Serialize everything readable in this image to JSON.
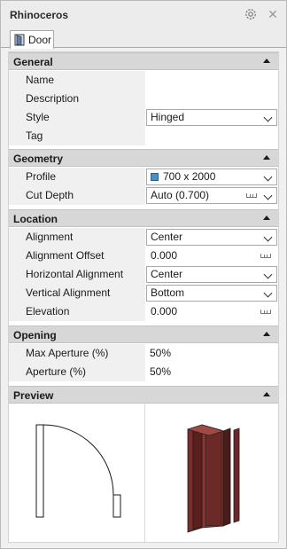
{
  "window": {
    "title": "Rhinoceros"
  },
  "tab": {
    "label": "Door"
  },
  "sections": {
    "general": {
      "title": "General",
      "name_label": "Name",
      "name_value": "",
      "description_label": "Description",
      "description_value": "",
      "style_label": "Style",
      "style_value": "Hinged",
      "tag_label": "Tag",
      "tag_value": ""
    },
    "geometry": {
      "title": "Geometry",
      "profile_label": "Profile",
      "profile_value": "700 x 2000",
      "profile_color": "#4a90c8",
      "cut_depth_label": "Cut Depth",
      "cut_depth_value": "Auto (0.700)"
    },
    "location": {
      "title": "Location",
      "alignment_label": "Alignment",
      "alignment_value": "Center",
      "alignment_offset_label": "Alignment Offset",
      "alignment_offset_value": "0.000",
      "horizontal_alignment_label": "Horizontal Alignment",
      "horizontal_alignment_value": "Center",
      "vertical_alignment_label": "Vertical Alignment",
      "vertical_alignment_value": "Bottom",
      "elevation_label": "Elevation",
      "elevation_value": "0.000"
    },
    "opening": {
      "title": "Opening",
      "max_aperture_label": "Max Aperture (%)",
      "max_aperture_value": "50%",
      "aperture_label": "Aperture (%)",
      "aperture_value": "50%"
    },
    "preview": {
      "title": "Preview",
      "door_color": "#6b2a28"
    }
  }
}
